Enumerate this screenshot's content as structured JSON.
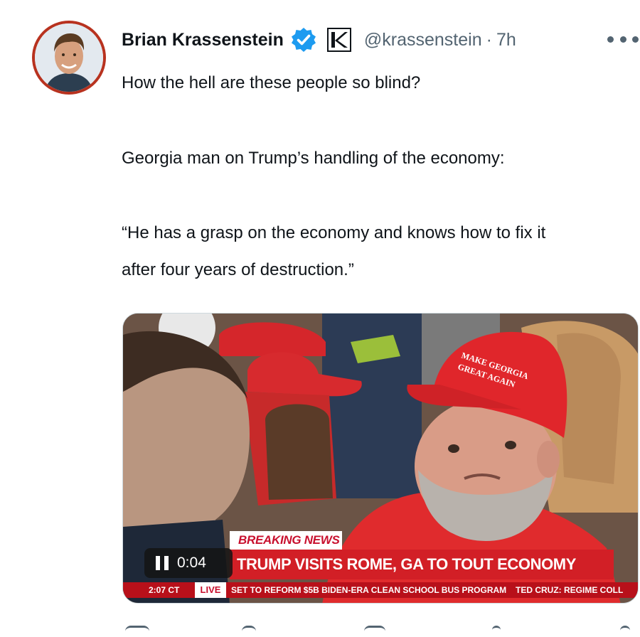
{
  "author": {
    "name": "Brian Krassenstein",
    "handle": "@krassenstein",
    "separator": "·",
    "time": "7h",
    "verified_badge_icon": "verified-badge-icon",
    "affiliate_icon": "k-logo-icon",
    "avatar_icon": "profile-avatar"
  },
  "tweet": {
    "lines": [
      "How the hell are these people so blind?",
      "Georgia man on Trump’s handling of the economy:",
      "“He has a grasp on the economy and knows how to fix it",
      "after four years of destruction.”"
    ]
  },
  "video": {
    "breaking_label": "BREAKING NEWS",
    "headline": "TRUMP VISITS ROME, GA TO TOUT ECONOMY",
    "ticker_time": "2:07 CT",
    "live_label": "LIVE",
    "ticker_text": "SET TO REFORM $5B BIDEN-ERA CLEAN SCHOOL BUS PROGRAM",
    "ticker_text_2": "TED CRUZ: REGIME COLL",
    "elapsed": "0:04",
    "hat_text_line1": "MAKE GEORGIA",
    "hat_text_line2": "GREAT AGAIN",
    "pause_icon": "pause-icon"
  },
  "colors": {
    "text_primary": "#0f1419",
    "text_secondary": "#536471",
    "verified_blue": "#1d9bf0",
    "news_red": "#d21f26"
  }
}
